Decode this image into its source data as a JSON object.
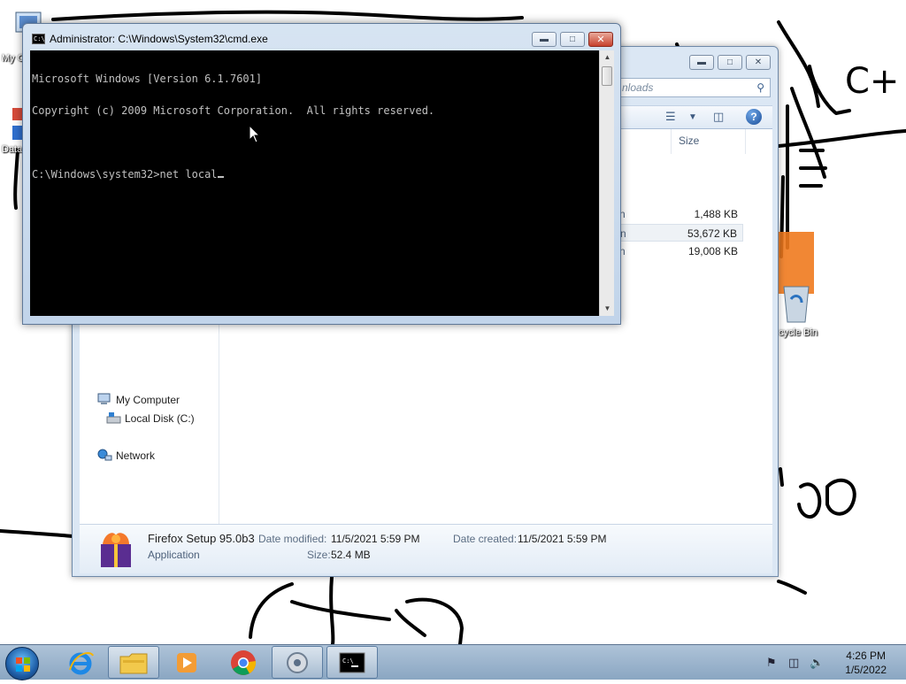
{
  "desktop": {
    "icons": [
      {
        "label": "My C",
        "name": "my-computer"
      },
      {
        "label": "Data",
        "name": "data"
      },
      {
        "label": "cycle Bin",
        "name": "recycle-bin"
      }
    ],
    "sketch_text": "C+"
  },
  "cmd": {
    "title": "Administrator: C:\\Windows\\System32\\cmd.exe",
    "lines": [
      "Microsoft Windows [Version 6.1.7601]",
      "Copyright (c) 2009 Microsoft Corporation.  All rights reserved.",
      "",
      "C:\\Windows\\system32>net local"
    ]
  },
  "explorer": {
    "search_placeholder": "nloads",
    "column_size": "Size",
    "files": [
      {
        "type": "n",
        "size": "1,488 KB",
        "selected": false
      },
      {
        "type": "n",
        "size": "53,672 KB",
        "selected": true
      },
      {
        "type": "n",
        "size": "19,008 KB",
        "selected": false
      }
    ],
    "nav": {
      "my_computer": "My Computer",
      "local_disk": "Local Disk (C:)",
      "network": "Network"
    },
    "details": {
      "file_name": "Firefox Setup 95.0b3",
      "file_type": "Application",
      "modified_label": "Date modified:",
      "modified_value": "11/5/2021 5:59 PM",
      "created_label": "Date created:",
      "created_value": "11/5/2021 5:59 PM",
      "size_label": "Size:",
      "size_value": "52.4 MB"
    }
  },
  "taskbar": {
    "apps": [
      "start",
      "internet-explorer",
      "windows-explorer",
      "media-player",
      "chrome",
      "settings",
      "command-prompt"
    ],
    "time": "4:26 PM",
    "date": "1/5/2022"
  },
  "colors": {
    "console_bg": "#000000",
    "console_fg": "#c0c0c0",
    "close_red": "#c7402c",
    "taskbar": "#9bb4cf"
  }
}
